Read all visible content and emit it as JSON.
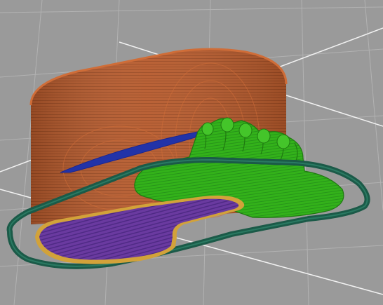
{
  "viewport": {
    "background": "#9a9a9a",
    "grid_color": "#b2b2b2",
    "axis_color": "#f2f2f2"
  },
  "colors": {
    "walls": "#b65a2c",
    "walls_dark": "#9c4a22",
    "walls_highlight": "#cf6d38",
    "support_green": "#33b21a",
    "support_green_dark": "#1f7a10",
    "skirt": "#1b5a48",
    "top_infill": "#6a3aa0",
    "top_infill_edge": "#d2a23a",
    "bridge_blue": "#2233a8"
  },
  "icons": {
    "scene": "3d-slicer-preview-icon"
  }
}
